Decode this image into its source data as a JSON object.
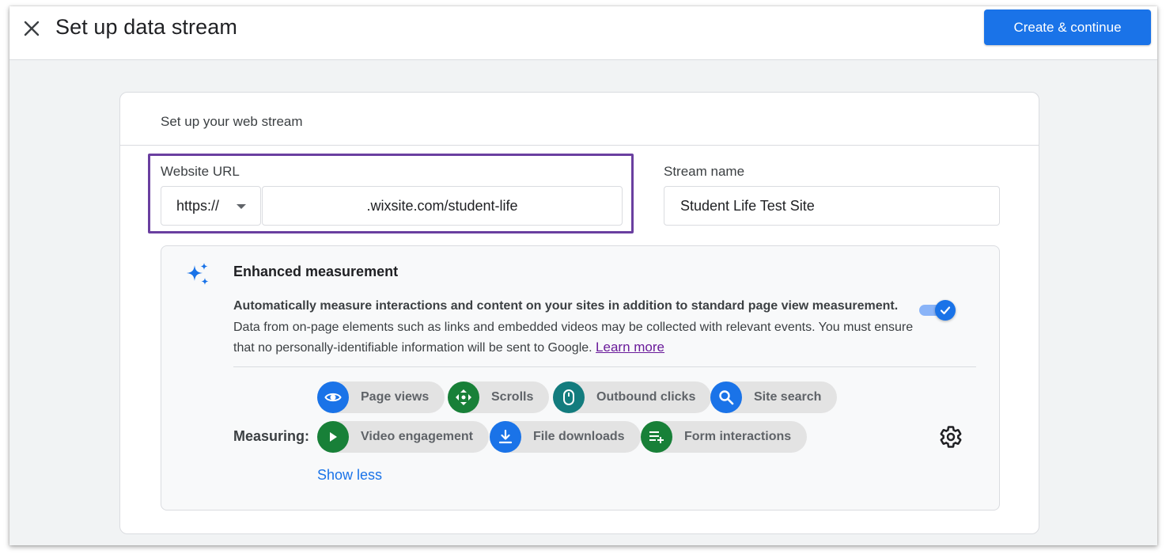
{
  "header": {
    "title": "Set up data stream",
    "primary_action": "Create & continue"
  },
  "card": {
    "title": "Set up your web stream",
    "website_url": {
      "label": "Website URL",
      "protocol": "https://",
      "value": ".wixsite.com/student-life"
    },
    "stream_name": {
      "label": "Stream name",
      "value": "Student Life Test Site"
    }
  },
  "enhanced_measurement": {
    "title": "Enhanced measurement",
    "summary": "Automatically measure interactions and content on your sites in addition to standard page view measurement.",
    "detail": "Data from on-page elements such as links and embedded videos may be collected with relevant events. You must ensure that no personally-identifiable information will be sent to Google.",
    "learn_more": "Learn more",
    "enabled": true,
    "measuring_label": "Measuring:",
    "chips": [
      {
        "label": "Page views",
        "icon": "eye-icon",
        "color": "#1a73e8"
      },
      {
        "label": "Scrolls",
        "icon": "scroll-arrows-icon",
        "color": "#188038"
      },
      {
        "label": "Outbound clicks",
        "icon": "mouse-icon",
        "color": "#137c7e"
      },
      {
        "label": "Site search",
        "icon": "search-icon",
        "color": "#1a73e8"
      },
      {
        "label": "Video engagement",
        "icon": "play-icon",
        "color": "#188038"
      },
      {
        "label": "File downloads",
        "icon": "download-icon",
        "color": "#1a73e8"
      },
      {
        "label": "Form interactions",
        "icon": "form-add-icon",
        "color": "#188038"
      }
    ],
    "show_less": "Show less"
  },
  "colors": {
    "accent": "#1a73e8",
    "highlight": "#6a3fa0"
  }
}
